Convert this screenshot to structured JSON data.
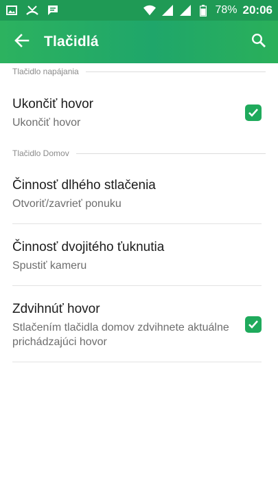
{
  "status_bar": {
    "battery_percent": "78%",
    "time": "20:06",
    "icons": [
      "image-icon",
      "missed-call-icon",
      "message-icon",
      "wifi-icon",
      "signal-icon",
      "signal-icon",
      "battery-icon"
    ]
  },
  "app_bar": {
    "title": "Tlačidlá",
    "back_icon": "arrow-back-icon",
    "search_icon": "search-icon"
  },
  "sections": [
    {
      "header": "Tlačidlo napájania",
      "items": [
        {
          "title": "Ukončiť hovor",
          "subtitle": "Ukončiť hovor",
          "checked": true
        }
      ]
    },
    {
      "header": "Tlačidlo Domov",
      "items": [
        {
          "title": "Činnosť dlhého stlačenia",
          "subtitle": "Otvoriť/zavrieť ponuku"
        },
        {
          "title": "Činnosť dvojitého ťuknutia",
          "subtitle": "Spustiť kameru"
        },
        {
          "title": "Zdvihnúť hovor",
          "subtitle": "Stlačením tlačidla domov zdvihnete aktuálne prichádzajúci hovor",
          "checked": true
        }
      ]
    }
  ],
  "colors": {
    "accent": "#1faa5c",
    "status_bar": "#1f9a55",
    "app_bar": "#2cb25f"
  }
}
